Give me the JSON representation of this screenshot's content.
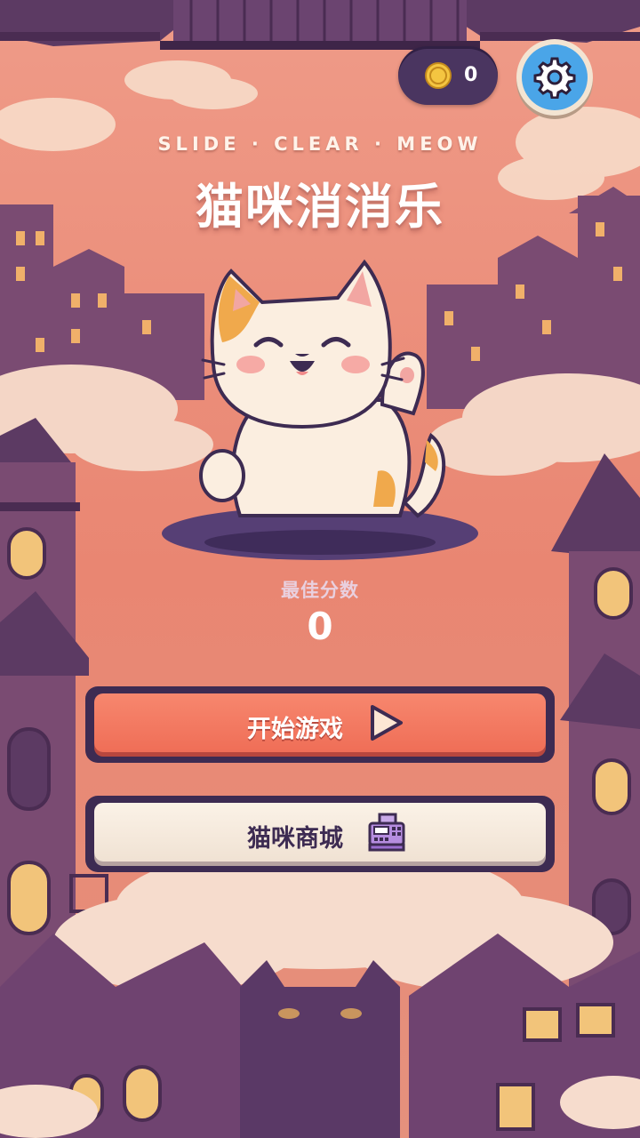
{
  "hud": {
    "coins": "0",
    "settings_icon": "gear-icon",
    "coin_icon": "coin-icon"
  },
  "header": {
    "subtitle": "SLIDE · CLEAR · MEOW",
    "title": "猫咪消消乐"
  },
  "score": {
    "best_label": "最佳分数",
    "best_value": "0"
  },
  "menu": {
    "start_label": "开始游戏",
    "start_icon": "play-icon",
    "shop_label": "猫咪商城",
    "shop_icon": "cash-register-icon"
  },
  "colors": {
    "sky": "#e8897a",
    "start_button": "#f07a62",
    "shop_button": "#f6ebde",
    "button_border": "#3d2b52",
    "settings_button": "#4aa5e8"
  }
}
